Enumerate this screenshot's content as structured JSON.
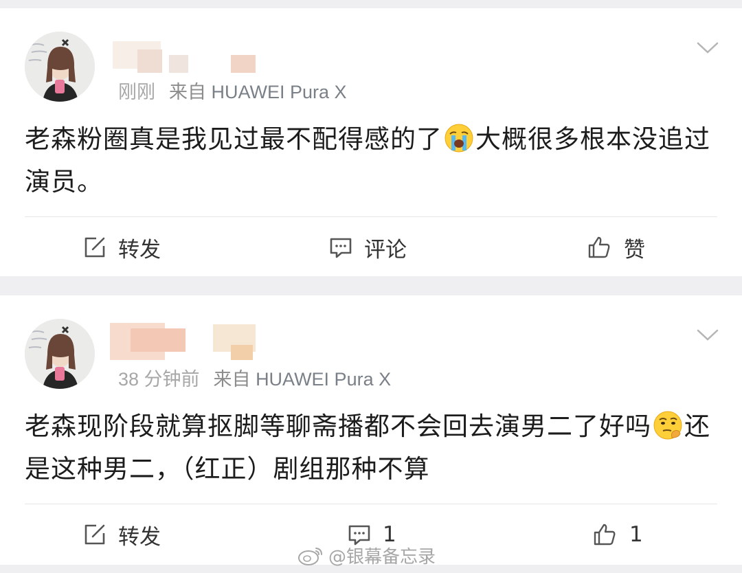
{
  "posts": [
    {
      "time": "刚刚",
      "via": "来自",
      "device": "HUAWEI Pura X",
      "text": "老森粉圈真是我见过最不配得感的了",
      "text_after_emoji": "大概很多根本没追过演员。",
      "emoji": "crying-face",
      "actions": {
        "repost": "转发",
        "comment": "评论",
        "like": "赞"
      }
    },
    {
      "time": "38 分钟前",
      "via": "来自",
      "device": "HUAWEI Pura X",
      "text": "老森现阶段就算抠脚等聊斋播都不会回去演男二了好吗",
      "text_after_emoji": "还是这种男二，（红正）剧组那种不算",
      "emoji": "thinking-face",
      "actions": {
        "repost": "转发",
        "comment": "1",
        "like": "1"
      }
    }
  ],
  "watermark": "@银幕备忘录",
  "colors": {
    "accent": "#333333",
    "meta": "#8f8f8f",
    "divider": "#e6e6e6"
  }
}
